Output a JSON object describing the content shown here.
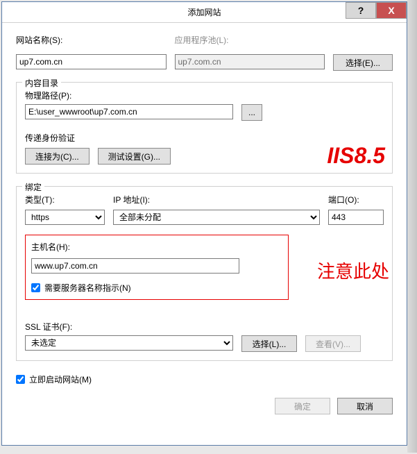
{
  "titlebar": {
    "title": "添加网站",
    "help": "?",
    "close": "X"
  },
  "site_name": {
    "label": "网站名称(S):",
    "value": "up7.com.cn"
  },
  "app_pool": {
    "label": "应用程序池(L):",
    "value": "up7.com.cn",
    "select_btn": "选择(E)..."
  },
  "content_dir": {
    "group_title": "内容目录",
    "path_label": "物理路径(P):",
    "path_value": "E:\\user_wwwroot\\up7.com.cn",
    "browse_btn": "...",
    "auth_label": "传递身份验证",
    "connect_as_btn": "连接为(C)...",
    "test_settings_btn": "测试设置(G)..."
  },
  "binding": {
    "group_title": "绑定",
    "type_label": "类型(T):",
    "type_value": "https",
    "ip_label": "IP 地址(I):",
    "ip_value": "全部未分配",
    "port_label": "端口(O):",
    "port_value": "443",
    "host_label": "主机名(H):",
    "host_value": "www.up7.com.cn",
    "sni_label": "需要服务器名称指示(N)",
    "ssl_cert_label": "SSL 证书(F):",
    "ssl_cert_value": "未选定",
    "ssl_select_btn": "选择(L)...",
    "ssl_view_btn": "查看(V)..."
  },
  "start_immediately": {
    "label": "立即启动网站(M)"
  },
  "footer": {
    "ok": "确定",
    "cancel": "取消"
  },
  "annotations": {
    "iis_version": "IIS8.5",
    "attention": "注意此处"
  }
}
